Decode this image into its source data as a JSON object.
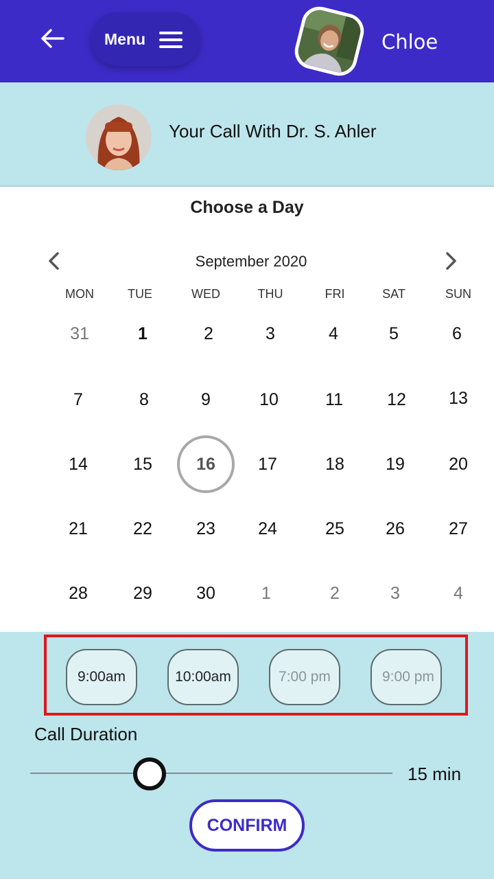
{
  "header": {
    "menu_label": "Menu",
    "user_name": "Chloe",
    "back_icon": "arrow-left-icon",
    "menu_icon": "hamburger-icon",
    "bg_color": "#3d2bc8"
  },
  "doctor": {
    "call_title": "Your Call With Dr. S. Ahler"
  },
  "calendar": {
    "heading": "Choose a Day",
    "month": "September 2020",
    "weekdays": [
      "MON",
      "TUE",
      "WED",
      "THU",
      "FRI",
      "SAT",
      "SUN"
    ],
    "weeks": [
      [
        "31",
        "1",
        "2",
        "3",
        "4",
        "5",
        "6"
      ],
      [
        "7",
        "8",
        "9",
        "10",
        "11",
        "12",
        "13"
      ],
      [
        "14",
        "15",
        "16",
        "17",
        "18",
        "19",
        "20"
      ],
      [
        "21",
        "22",
        "23",
        "24",
        "25",
        "26",
        "27"
      ],
      [
        "28",
        "29",
        "30",
        "1",
        "2",
        "3",
        "4"
      ]
    ],
    "selected_day": "16"
  },
  "time_slots": [
    {
      "label": "9:00am",
      "enabled": true
    },
    {
      "label": "10:00am",
      "enabled": true
    },
    {
      "label": "7:00 pm",
      "enabled": false
    },
    {
      "label": "9:00 pm",
      "enabled": false
    }
  ],
  "duration": {
    "label": "Call Duration",
    "value_text": "15 min",
    "slider_fraction": 0.33
  },
  "confirm_label": "CONFIRM",
  "colors": {
    "accent": "#3d2bc8",
    "panel": "#bde5ec",
    "highlight_border": "#e0161b"
  }
}
